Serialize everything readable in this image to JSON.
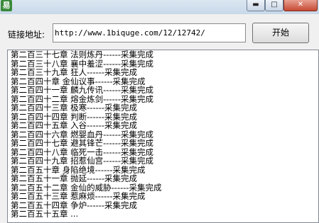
{
  "window": {
    "icon_char": "易"
  },
  "form": {
    "url_label": "链接地址:",
    "url_value": "http://www.1biquge.com/12/12742/",
    "start_label": "开始"
  },
  "log": [
    "第二百三十七章 法则炼丹------采集完成",
    "第二百三十八章 襄中羞涩------采集完成",
    "第二百三十九章 狂人------采集完成",
    "第二百四十章 金仙议事------采集完成",
    "第二百四十一章 麟九传讯------采集完成",
    "第二百四十二章 熔金炼剑------采集完成",
    "第二百四十三章 极寒------采集完成",
    "第二百四十四章 判断------采集完成",
    "第二百四十五章 入谷------采集完成",
    "第二百四十六章 燃婴血丹------采集完成",
    "第二百四十七章 避其锋芒------采集完成",
    "第二百四十八章 临死一击------采集完成",
    "第二百四十九章 招惹仙宫------采集完成",
    "第二百五十章 身陷绝境------采集完成",
    "第二百五十一章 抛延------采集完成",
    "第二百五十二章 金仙的威胁------采集完成",
    "第二百五十三章 惹麻烦------采集完成",
    "第二百五十四章 争炉------采集完成",
    "第二百五十五章 ..."
  ]
}
